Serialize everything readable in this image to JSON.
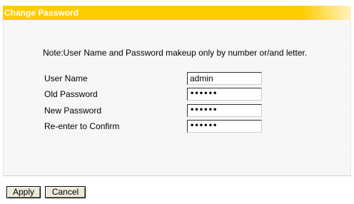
{
  "header": {
    "title": "Change Password"
  },
  "note": "Note:User Name and Password makeup only by number or/and letter.",
  "form": {
    "fields": [
      {
        "label": "User Name",
        "value": "admin"
      },
      {
        "label": "Old Password",
        "value": "••••••"
      },
      {
        "label": "New Password",
        "value": "••••••"
      },
      {
        "label": "Re-enter to Confirm",
        "value": "••••••"
      }
    ]
  },
  "buttons": {
    "apply": "Apply",
    "cancel": "Cancel"
  },
  "colors": {
    "title_bar": "#ffcc00",
    "title_text": "#ffffff"
  }
}
